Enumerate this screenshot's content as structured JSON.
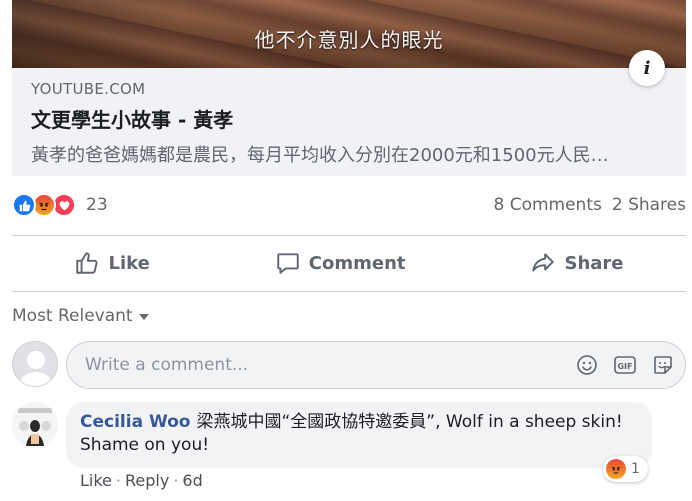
{
  "preview": {
    "caption": "他不介意別人的眼光",
    "domain": "YOUTUBE.COM",
    "title": "文更學生小故事 - 黃孝",
    "description": "黃孝的爸爸媽媽都是農民，每月平均收入分別在2000元和1500元人民…",
    "info_icon": "info-icon"
  },
  "reactions": {
    "types": [
      "like-icon",
      "angry-icon",
      "love-icon"
    ],
    "count": "23",
    "comments": "8 Comments",
    "shares": "2 Shares"
  },
  "actions": {
    "like": "Like",
    "comment": "Comment",
    "share": "Share"
  },
  "comments_section": {
    "sort_label": "Most Relevant",
    "composer_placeholder": "Write a comment...",
    "tools": [
      "emoji-icon",
      "gif-icon",
      "sticker-icon"
    ]
  },
  "comment": {
    "author": "Cecilia Woo",
    "text": "梁燕城中國“全國政協特邀委員”, Wolf in a sheep skin! Shame on you!",
    "reaction_count": "1",
    "like": "Like",
    "reply": "Reply",
    "age": "6d"
  },
  "colors": {
    "brand_blue": "#1877f2",
    "author_blue": "#385898",
    "love_red": "#f33e58"
  }
}
